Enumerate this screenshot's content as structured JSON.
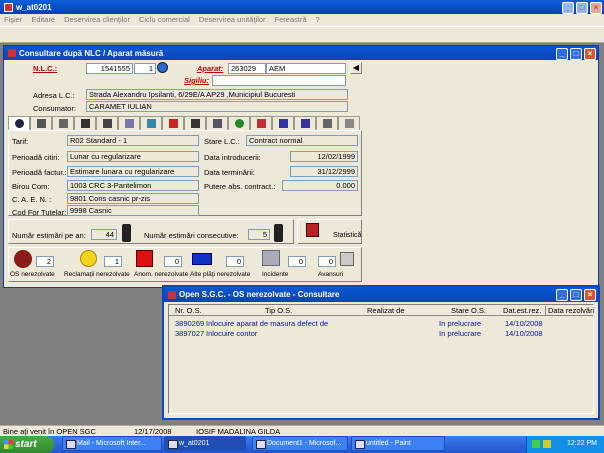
{
  "app": {
    "title": "w_at0201",
    "menu": [
      "Fişier",
      "Editare",
      "Deservirea clienţilor",
      "Ciclu comercial",
      "Deservirea unităţilor",
      "Fereastră",
      "?"
    ]
  },
  "form": {
    "title": "Consultare după NLC / Aparat măsură",
    "nlc_label": "N.L.C.:",
    "nlc_value": "1541555",
    "nlc_seq": "1",
    "aparat_label": "Aparat:",
    "aparat_value": "263029",
    "aparat_type": "AEM",
    "sigiliu_label": "Sigiliu:",
    "sigiliu_value": "",
    "adresa_label": "Adresa L.C.:",
    "adresa_value": "Strada Alexandru Ipsilanti, 6/29E/A AP29 ,Municipiul Bucuresti",
    "consumator_label": "Consumator:",
    "consumator_value": "CARAMET  IULIAN",
    "details": {
      "tarif_label": "Tarif:",
      "tarif_value": "R02 Standard - 1",
      "stare_label": "Stare L.C.:",
      "stare_value": "Contract normal",
      "perioada_citiri_label": "Perioadă citiri:",
      "perioada_citiri_value": "Lunar cu regularizare",
      "data_intro_label": "Data introducerii:",
      "data_intro_value": "12/02/1999",
      "perioada_fact_label": "Perioadă factur.:",
      "perioada_fact_value": "Estimare lunara cu regularizare",
      "data_term_label": "Data terminării:",
      "data_term_value": "31/12/2999",
      "birou_label": "Birou Com:",
      "birou_value": "1003  CRC 3-Pantelimon",
      "putere_label": "Putere abs. contract.:",
      "putere_value": "0.000",
      "caen_label": "C. A. E. N. :",
      "caen_value": "9801   Cons casnic pr-zis",
      "cod_label": "Cod For Tutelar:",
      "cod_value": "9998   Casnic"
    },
    "estimari": {
      "label": "Număr estimări pe an:",
      "value": "44",
      "consec_label": "Număr estimări consecutive:",
      "consec_value": "5",
      "statistica_label": "Statistică"
    },
    "counters": [
      {
        "label": "OS nerezolvate",
        "value": "2"
      },
      {
        "label": "Reclamaţii nerezolvate",
        "value": "1"
      },
      {
        "label": "Anom. nerezolvate",
        "value": "0"
      },
      {
        "label": "Alte plăţi nerezolvate",
        "value": "0"
      },
      {
        "label": "Incidente",
        "value": "0"
      },
      {
        "label": "Avansuri",
        "value": "0"
      }
    ]
  },
  "dialog": {
    "title": "Open S.G.C. - OS nerezolvate - Consultare",
    "columns": [
      "Nr. O.S.",
      "Tip O.S.",
      "Realizat de",
      "Stare O.S.",
      "Dat.est.rez.",
      "Data rezolvări"
    ],
    "rows": [
      {
        "nr": "3890269",
        "tip": "Inlocuire aparat de masura defect de",
        "realizat": "",
        "stare": "In prelucrare",
        "dat_est": "14/10/2008",
        "data_rez": ""
      },
      {
        "nr": "3897027",
        "tip": "Inlocuire contor",
        "realizat": "",
        "stare": "In prelucrare",
        "dat_est": "14/10/2008",
        "data_rez": ""
      }
    ]
  },
  "status": {
    "message": "Bine aţi venit în OPEN SGC",
    "date": "12/17/2008",
    "user": "IOSIF MADALINA GILDA"
  },
  "taskbar": {
    "start": "start",
    "items": [
      "Mail - Microsoft Inter...",
      "w_at0201",
      "Document1 - Microsof...",
      "untitled - Paint"
    ],
    "clock": "12:22 PM"
  }
}
